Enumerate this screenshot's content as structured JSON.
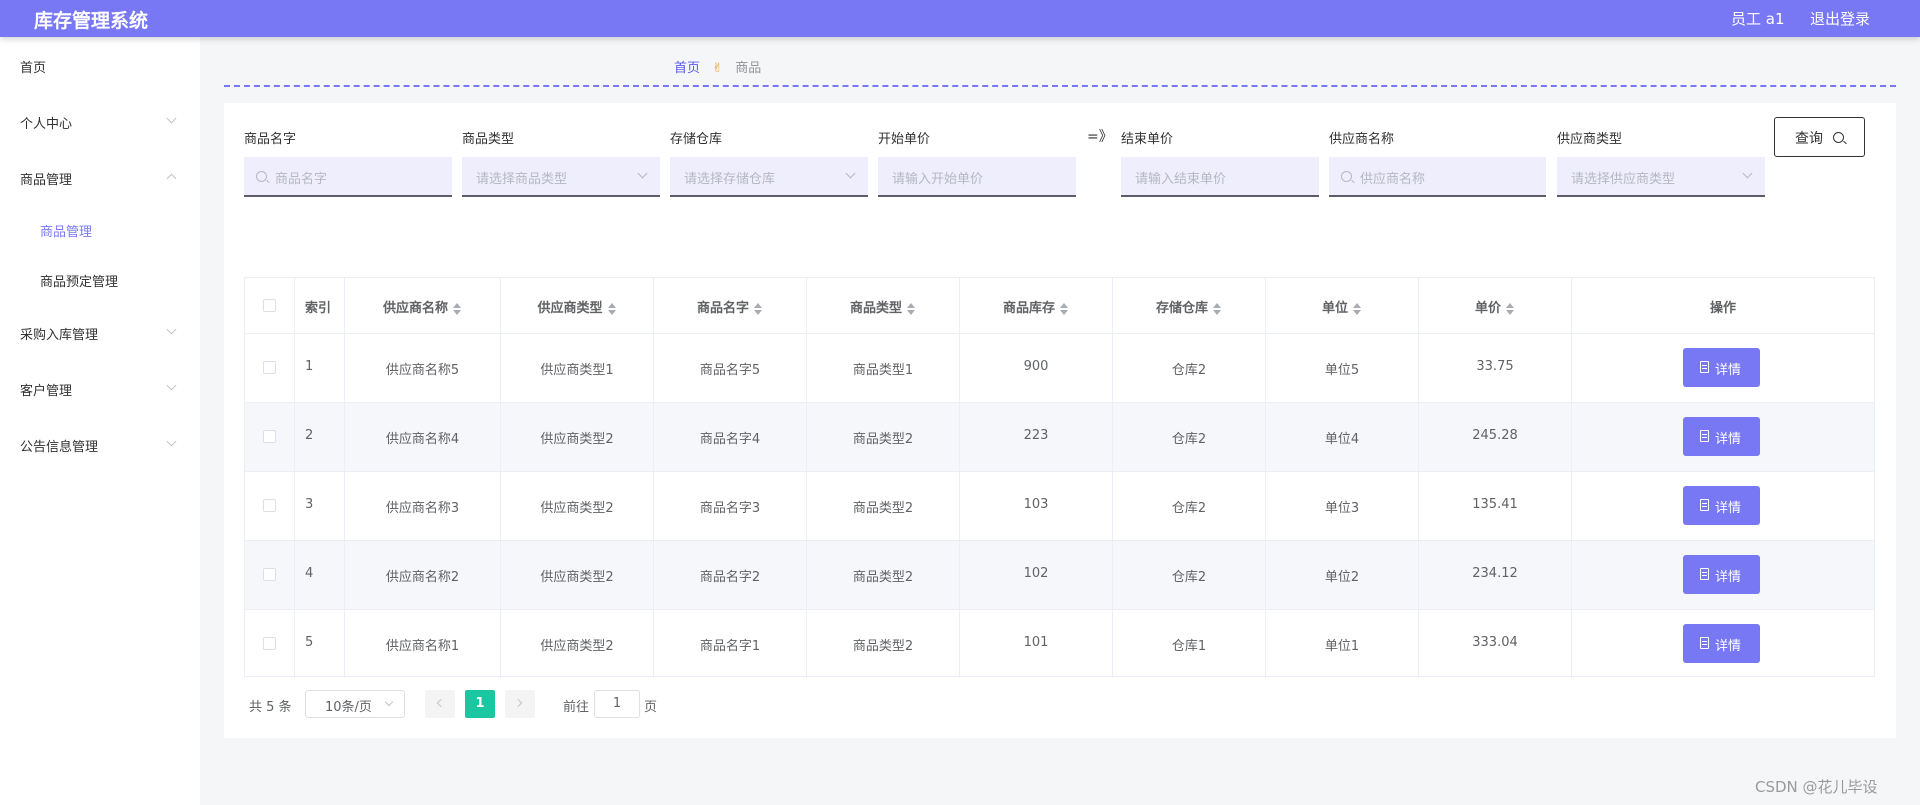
{
  "header": {
    "title": "库存管理系统",
    "user": "员工 a1",
    "logout": "退出登录"
  },
  "sidebar": {
    "items": [
      {
        "label": "首页"
      },
      {
        "label": "个人中心"
      },
      {
        "label": "商品管理"
      },
      {
        "label": "商品管理"
      },
      {
        "label": "商品预定管理"
      },
      {
        "label": "采购入库管理"
      },
      {
        "label": "客户管理"
      },
      {
        "label": "公告信息管理"
      }
    ]
  },
  "breadcrumb": {
    "home": "首页",
    "separator": "✌",
    "current": "商品"
  },
  "filters": {
    "fields": [
      {
        "label": "商品名字",
        "placeholder": "商品名字"
      },
      {
        "label": "商品类型",
        "placeholder": "请选择商品类型"
      },
      {
        "label": "存储仓库",
        "placeholder": "请选择存储仓库"
      },
      {
        "label": "开始单价",
        "placeholder": "请输入开始单价"
      },
      {
        "label": "结束单价",
        "placeholder": "请输入结束单价"
      },
      {
        "label": "供应商名称",
        "placeholder": "供应商名称"
      },
      {
        "label": "供应商类型",
        "placeholder": "请选择供应商类型"
      }
    ],
    "range_sep": "=》",
    "query_label": "查询"
  },
  "table": {
    "headers": [
      "索引",
      "供应商名称",
      "供应商类型",
      "商品名字",
      "商品类型",
      "商品库存",
      "存储仓库",
      "单位",
      "单价",
      "操作"
    ],
    "rows": [
      [
        "1",
        "供应商名称5",
        "供应商类型1",
        "商品名字5",
        "商品类型1",
        "900",
        "仓库2",
        "单位5",
        "33.75"
      ],
      [
        "2",
        "供应商名称4",
        "供应商类型2",
        "商品名字4",
        "商品类型2",
        "223",
        "仓库2",
        "单位4",
        "245.28"
      ],
      [
        "3",
        "供应商名称3",
        "供应商类型2",
        "商品名字3",
        "商品类型2",
        "103",
        "仓库2",
        "单位3",
        "135.41"
      ],
      [
        "4",
        "供应商名称2",
        "供应商类型2",
        "商品名字2",
        "商品类型2",
        "102",
        "仓库2",
        "单位2",
        "234.12"
      ],
      [
        "5",
        "供应商名称1",
        "供应商类型2",
        "商品名字1",
        "商品类型2",
        "101",
        "仓库1",
        "单位1",
        "333.04"
      ]
    ],
    "action_label": "详情"
  },
  "pagination": {
    "total": "共 5 条",
    "page_size": "10条/页",
    "current": "1",
    "goto_prefix": "前往",
    "goto_value": "1",
    "goto_suffix": "页"
  },
  "watermark": "CSDN @花儿毕设",
  "colors": {
    "accent": "#7878f5",
    "pager_active": "#1bc7a0"
  }
}
